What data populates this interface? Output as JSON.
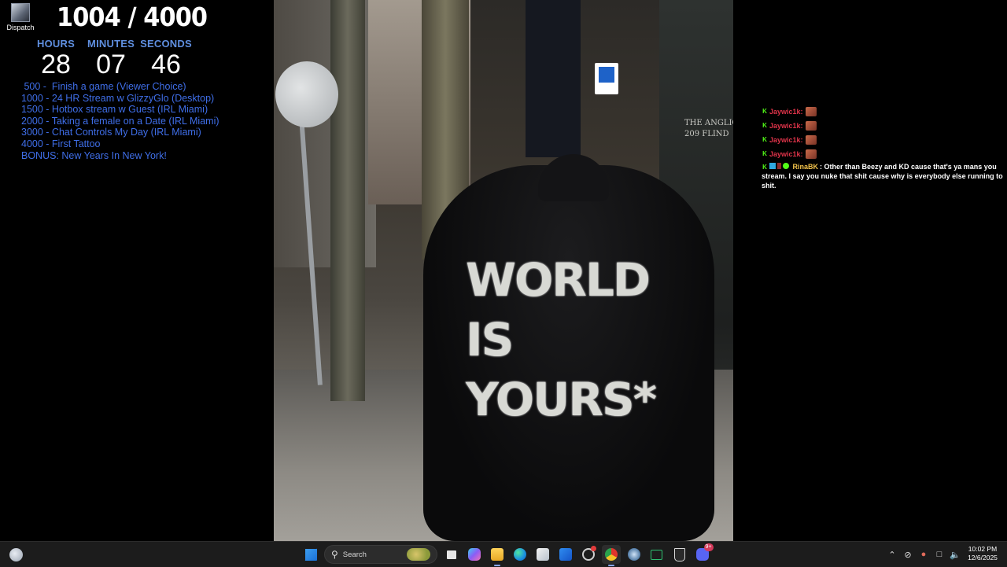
{
  "desktop": {
    "icon_label": "Dispatch"
  },
  "overlay": {
    "goal_counter": "1004 / 4000",
    "timer": [
      {
        "label": "HOURS",
        "value": "28"
      },
      {
        "label": "MINUTES",
        "value": "07"
      },
      {
        "label": "SECONDS",
        "value": "46"
      }
    ],
    "goals": [
      " 500 -  Finish a game (Viewer Choice)",
      "1000 - 24 HR Stream w GlizzyGlo (Desktop)",
      "1500 - Hotbox stream w Guest (IRL Miami)",
      "2000 - Taking a female on a Date (IRL Miami)",
      "3000 - Chat Controls My Day (IRL Miami)",
      "4000 - First Tattoo",
      "BONUS: New Years In New York!"
    ]
  },
  "photo": {
    "hoodie_text": [
      "WORLD",
      "IS",
      "YOURS*"
    ],
    "building_text": [
      "THE ANGLIC",
      "209 FLIND"
    ],
    "parking_sign": "P"
  },
  "chat": {
    "messages": [
      {
        "user": "Jaywic1k",
        "text": ":"
      },
      {
        "user": "Jaywic1k",
        "text": ":"
      },
      {
        "user": "Jaywic1k",
        "text": ":"
      },
      {
        "user": "Jaywic1k",
        "text": ":"
      }
    ],
    "long_message": {
      "user": "RinaBK",
      "text": "Other than Beezy and KD cause that's ya mans you stream. I say you nuke that shit cause why is everybody else running to shit."
    }
  },
  "taskbar": {
    "search_placeholder": "Search",
    "clock_time": "10:02 PM",
    "clock_date": "12/6/2025",
    "discord_badge": "9+",
    "icons": [
      "windows-start-icon",
      "search-icon",
      "task-view-icon",
      "copilot-icon",
      "file-explorer-icon",
      "edge-icon",
      "microsoft-store-icon",
      "mail-icon",
      "snipping-tool-icon",
      "chrome-icon",
      "steam-icon",
      "xbox-icon",
      "epic-games-icon",
      "discord-icon"
    ]
  }
}
